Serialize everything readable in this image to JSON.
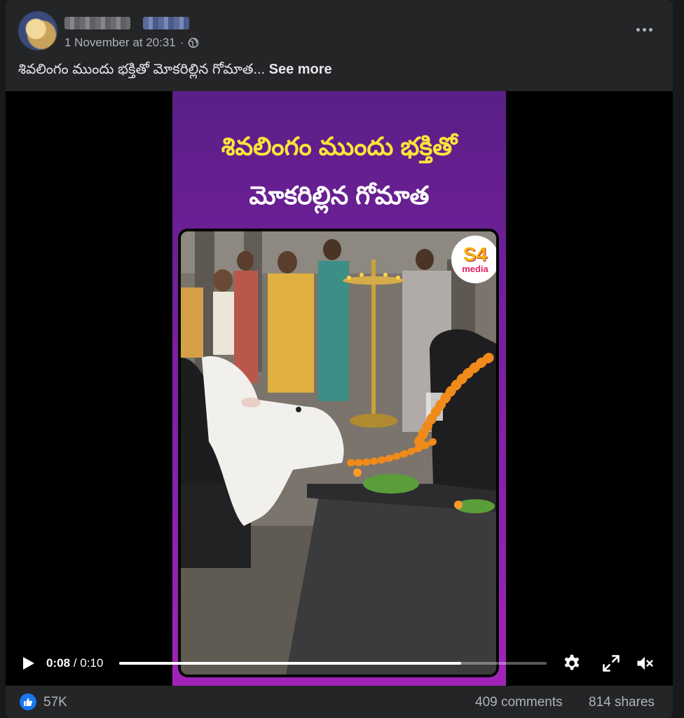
{
  "post": {
    "timestamp": "1 November at 20:31",
    "separator": "·",
    "privacy_icon": "globe-icon",
    "menu_icon": "more-options-icon",
    "caption": "శివలింగం ముందు భక్తితో మోకరిల్లిన గోమాత...",
    "see_more_label": "See more"
  },
  "video": {
    "overlay_title_line1": "శివలింగం ముందు భక్తితో",
    "overlay_title_line2": "మోకరిల్లిన గోమాత",
    "logo_top": "S4",
    "logo_bottom": "media",
    "current_time": "0:08",
    "time_separator": "/",
    "duration": "0:10",
    "progress_fraction": 0.8,
    "icons": [
      "play-icon",
      "settings-gear-icon",
      "fullscreen-icon",
      "muted-speaker-icon"
    ],
    "colors": {
      "title_line1": "#ffe43a",
      "title_line2": "#ffffff",
      "frame_top": "#5a1f86",
      "frame_bottom": "#a023b8"
    }
  },
  "footer": {
    "reaction_icon": "like-icon",
    "likes": "57K",
    "comments": "409 comments",
    "shares": "814 shares"
  },
  "colors": {
    "background": "#18191a",
    "card": "#242526",
    "accent": "#1877f2",
    "text": "#e4e6eb",
    "secondary_text": "#b0b3b8"
  }
}
